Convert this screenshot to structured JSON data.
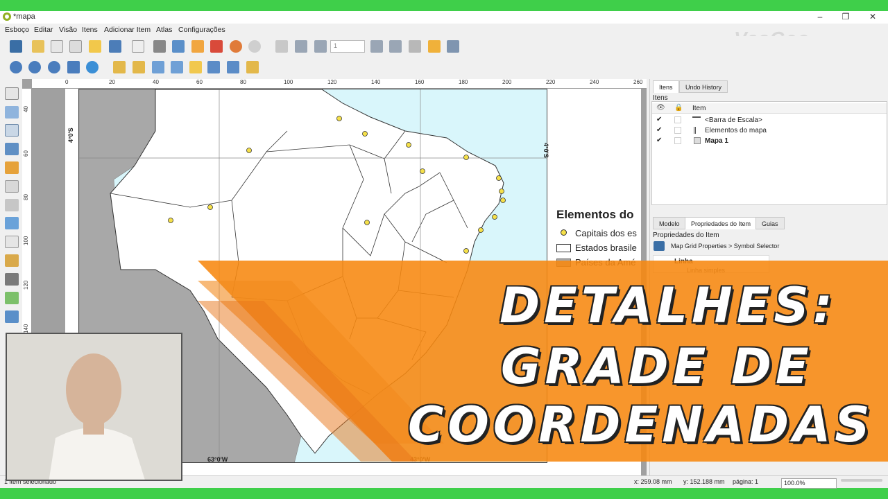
{
  "window": {
    "title": "*mapa",
    "minimize": "–",
    "maximize": "❐",
    "close": "✕"
  },
  "watermark": "VasGeo",
  "menu": [
    "Esboço",
    "Editar",
    "Visão",
    "Itens",
    "Adicionar Item",
    "Atlas",
    "Configurações"
  ],
  "toolbar": {
    "page_number": "1"
  },
  "ruler_top": [
    "0",
    "20",
    "40",
    "60",
    "80",
    "100",
    "120",
    "140",
    "160",
    "180",
    "200",
    "220",
    "240",
    "260"
  ],
  "ruler_left": [
    "40",
    "60",
    "80",
    "100",
    "120",
    "140"
  ],
  "map": {
    "grid_labels": {
      "lat_left": "4°0'S",
      "lat_right": "4°0'S",
      "lon_west": "63°0'W",
      "lon_east": "43°0'W"
    }
  },
  "legend": {
    "title": "Elementos do",
    "entries": [
      "Capitais dos es",
      "Estados brasile",
      "Países da Amé"
    ]
  },
  "right_panel": {
    "tabs_top": [
      "Itens",
      "Undo History"
    ],
    "items_label": "Itens",
    "items_header": "Item",
    "items": [
      {
        "name": "<Barra de Escala>",
        "checked": true
      },
      {
        "name": "Elementos do mapa",
        "checked": true
      },
      {
        "name": "Mapa 1",
        "checked": true,
        "bold": true
      }
    ],
    "tabs_bottom": [
      "Modelo",
      "Propriedades do Item",
      "Guias"
    ],
    "props_label": "Propriedades do Item",
    "breadcrumb": "Map Grid Properties > Symbol Selector",
    "symbol_tree": [
      "Linha",
      "Linha simples"
    ]
  },
  "status": {
    "selection": "1 item selecionado",
    "x": "x: 259.08 mm",
    "y": "y: 152.188 mm",
    "page": "página: 1",
    "zoom": "100.0%"
  },
  "banner": [
    "DETALHES:",
    "GRADE DE",
    "COORDENADAS"
  ],
  "colors": {
    "accent_orange": "#f7870f",
    "ocean": "#d9f6fb",
    "foreign_land": "#a8a8a8",
    "frame_green": "#3fcf4a"
  }
}
